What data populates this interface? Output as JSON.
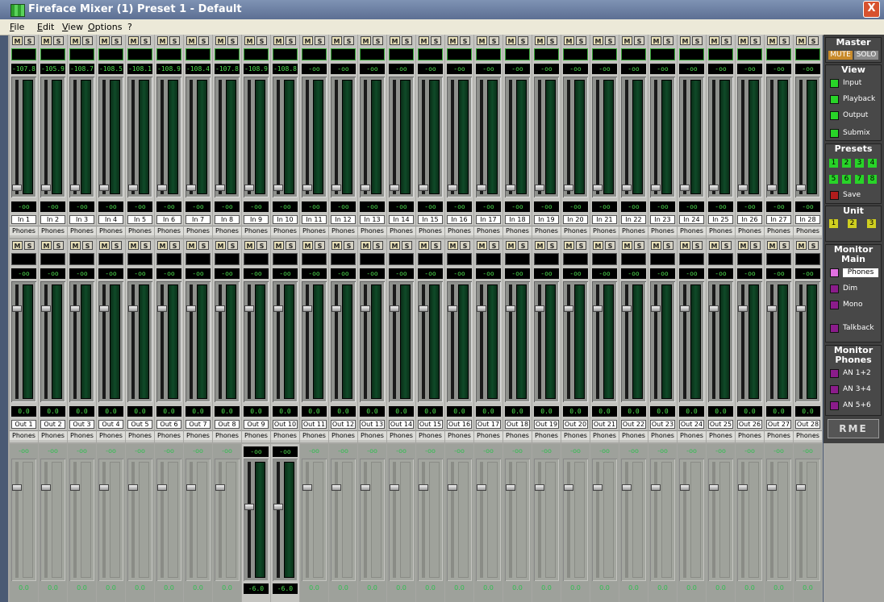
{
  "window": {
    "title": "Fireface Mixer (1) Preset 1 - Default",
    "close_label": "X"
  },
  "menu": [
    "File",
    "Edit",
    "View",
    "Options",
    "?"
  ],
  "strip_buttons": {
    "mute": "M",
    "solo": "S"
  },
  "input_row": {
    "levels": [
      "-107.8",
      "-105.9",
      "-108.7",
      "-108.5",
      "-108.1",
      "-108.9",
      "-108.4",
      "-107.8",
      "-108.9",
      "-108.8",
      "-oo",
      "-oo",
      "-oo",
      "-oo",
      "-oo",
      "-oo",
      "-oo",
      "-oo",
      "-oo",
      "-oo",
      "-oo",
      "-oo",
      "-oo",
      "-oo",
      "-oo",
      "-oo",
      "-oo",
      "-oo"
    ],
    "gains": [
      "-oo",
      "-oo",
      "-oo",
      "-oo",
      "-oo",
      "-oo",
      "-oo",
      "-oo",
      "-oo",
      "-oo",
      "-oo",
      "-oo",
      "-oo",
      "-oo",
      "-oo",
      "-oo",
      "-oo",
      "-oo",
      "-oo",
      "-oo",
      "-oo",
      "-oo",
      "-oo",
      "-oo",
      "-oo",
      "-oo",
      "-oo",
      "-oo"
    ],
    "names": [
      "In 1",
      "In 2",
      "In 3",
      "In 4",
      "In 5",
      "In 6",
      "In 7",
      "In 8",
      "In 9",
      "In 10",
      "In 11",
      "In 12",
      "In 13",
      "In 14",
      "In 15",
      "In 16",
      "In 17",
      "In 18",
      "In 19",
      "In 20",
      "In 21",
      "In 22",
      "In 23",
      "In 24",
      "In 25",
      "In 26",
      "In 27",
      "In 28"
    ],
    "route": "Phones"
  },
  "playback_row": {
    "levels": [
      "-oo",
      "-oo",
      "-oo",
      "-oo",
      "-oo",
      "-oo",
      "-oo",
      "-oo",
      "-oo",
      "-oo",
      "-oo",
      "-oo",
      "-oo",
      "-oo",
      "-oo",
      "-oo",
      "-oo",
      "-oo",
      "-oo",
      "-oo",
      "-oo",
      "-oo",
      "-oo",
      "-oo",
      "-oo",
      "-oo",
      "-oo",
      "-oo"
    ],
    "gains": [
      "0.0",
      "0.0",
      "0.0",
      "0.0",
      "0.0",
      "0.0",
      "0.0",
      "0.0",
      "0.0",
      "0.0",
      "0.0",
      "0.0",
      "0.0",
      "0.0",
      "0.0",
      "0.0",
      "0.0",
      "0.0",
      "0.0",
      "0.0",
      "0.0",
      "0.0",
      "0.0",
      "0.0",
      "0.0",
      "0.0",
      "0.0",
      "0.0"
    ],
    "names": [
      "Out 1",
      "Out 2",
      "Out 3",
      "Out 4",
      "Out 5",
      "Out 6",
      "Out 7",
      "Out 8",
      "Out 9",
      "Out 10",
      "Out 11",
      "Out 12",
      "Out 13",
      "Out 14",
      "Out 15",
      "Out 16",
      "Out 17",
      "Out 18",
      "Out 19",
      "Out 20",
      "Out 21",
      "Out 22",
      "Out 23",
      "Out 24",
      "Out 25",
      "Out 26",
      "Out 27",
      "Out 28"
    ],
    "route": "Phones"
  },
  "output_row": {
    "levels": [
      "-oo",
      "-oo",
      "-oo",
      "-oo",
      "-oo",
      "-oo",
      "-oo",
      "-oo",
      "-oo",
      "-oo",
      "-oo",
      "-oo",
      "-oo",
      "-oo",
      "-oo",
      "-oo",
      "-oo",
      "-oo",
      "-oo",
      "-oo",
      "-oo",
      "-oo",
      "-oo",
      "-oo",
      "-oo",
      "-oo",
      "-oo",
      "-oo"
    ],
    "gains": [
      "0.0",
      "0.0",
      "0.0",
      "0.0",
      "0.0",
      "0.0",
      "0.0",
      "0.0",
      "-6.0",
      "-6.0",
      "0.0",
      "0.0",
      "0.0",
      "0.0",
      "0.0",
      "0.0",
      "0.0",
      "0.0",
      "0.0",
      "0.0",
      "0.0",
      "0.0",
      "0.0",
      "0.0",
      "0.0",
      "0.0",
      "0.0",
      "0.0"
    ],
    "active_channels": [
      9,
      10
    ]
  },
  "master": {
    "title": "Master",
    "mute": "MUTE",
    "solo": "SOLO"
  },
  "view": {
    "title": "View",
    "items": [
      "Input",
      "Playback",
      "Output",
      "Submix"
    ]
  },
  "presets": {
    "title": "Presets",
    "buttons": [
      "1",
      "2",
      "3",
      "4",
      "5",
      "6",
      "7",
      "8"
    ],
    "save": "Save"
  },
  "unit": {
    "title": "Unit",
    "buttons": [
      "1",
      "2",
      "3"
    ]
  },
  "monitor_main": {
    "title1": "Monitor",
    "title2": "Main",
    "items": [
      "Phones",
      "Dim",
      "Mono",
      "Talkback"
    ]
  },
  "monitor_phones": {
    "title1": "Monitor",
    "title2": "Phones",
    "items": [
      "AN 1+2",
      "AN 3+4",
      "AN 5+6"
    ]
  },
  "logo": "RME",
  "colors": {
    "led_green": "#28d428",
    "led_purple": "#8b1c8b",
    "led_red": "#b01c1c",
    "led_yellow": "#cfcf20",
    "meter_text": "#4fe24f",
    "panel_bg": "#484848"
  }
}
